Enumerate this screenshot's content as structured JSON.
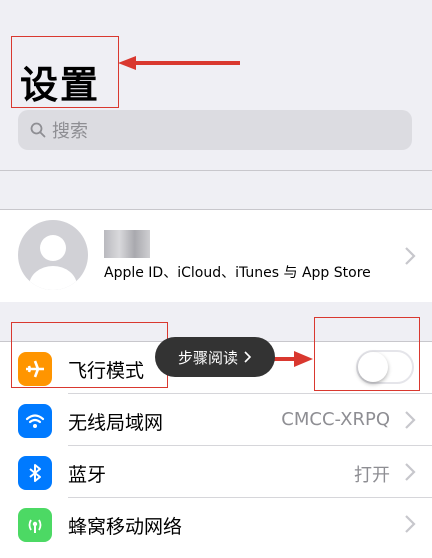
{
  "header": {
    "title": "设置"
  },
  "search": {
    "placeholder": "搜索"
  },
  "profile": {
    "subtitle": "Apple ID、iCloud、iTunes 与 App Store"
  },
  "rows": [
    {
      "label": "飞行模式",
      "value": "",
      "icon": "airplane-icon",
      "color": "#ff9500"
    },
    {
      "label": "无线局域网",
      "value": "CMCC-XRPQ",
      "icon": "wifi-icon",
      "color": "#007aff"
    },
    {
      "label": "蓝牙",
      "value": "打开",
      "icon": "bluetooth-icon",
      "color": "#007aff"
    },
    {
      "label": "蜂窝移动网络",
      "value": "",
      "icon": "cellular-icon",
      "color": "#4cd964"
    }
  ],
  "airplane_mode": {
    "on": false
  },
  "overlay": {
    "tooltip": "步骤阅读",
    "annotation_color": "#d9382f"
  }
}
